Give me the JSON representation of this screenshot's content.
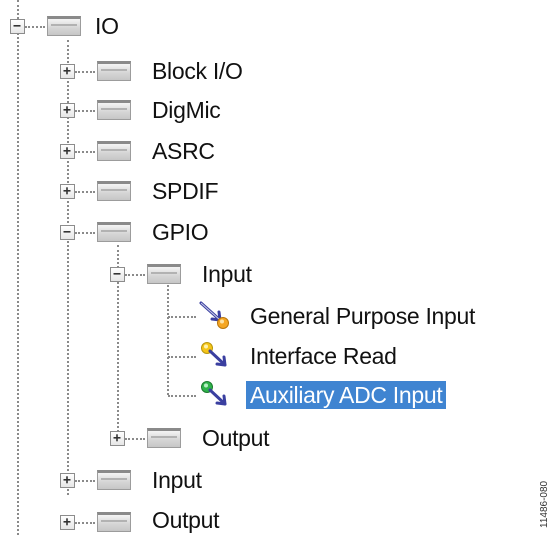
{
  "tree": {
    "root": {
      "label": "IO",
      "expanded": true
    },
    "nodes": [
      {
        "label": "Block I/O",
        "expanded": false
      },
      {
        "label": "DigMic",
        "expanded": false
      },
      {
        "label": "ASRC",
        "expanded": false
      },
      {
        "label": "SPDIF",
        "expanded": false
      },
      {
        "label": "GPIO",
        "expanded": true
      },
      {
        "label": "Input",
        "expanded": true
      },
      {
        "label": "General Purpose Input"
      },
      {
        "label": "Interface Read"
      },
      {
        "label": "Auxiliary ADC Input",
        "selected": true
      },
      {
        "label": "Output",
        "expanded": false
      },
      {
        "label": "Input",
        "expanded": false
      },
      {
        "label": "Output",
        "expanded": false
      }
    ]
  },
  "figure_id": "11486-080",
  "colors": {
    "selection": "#3f84d1",
    "connector": "#8a8a8a"
  }
}
